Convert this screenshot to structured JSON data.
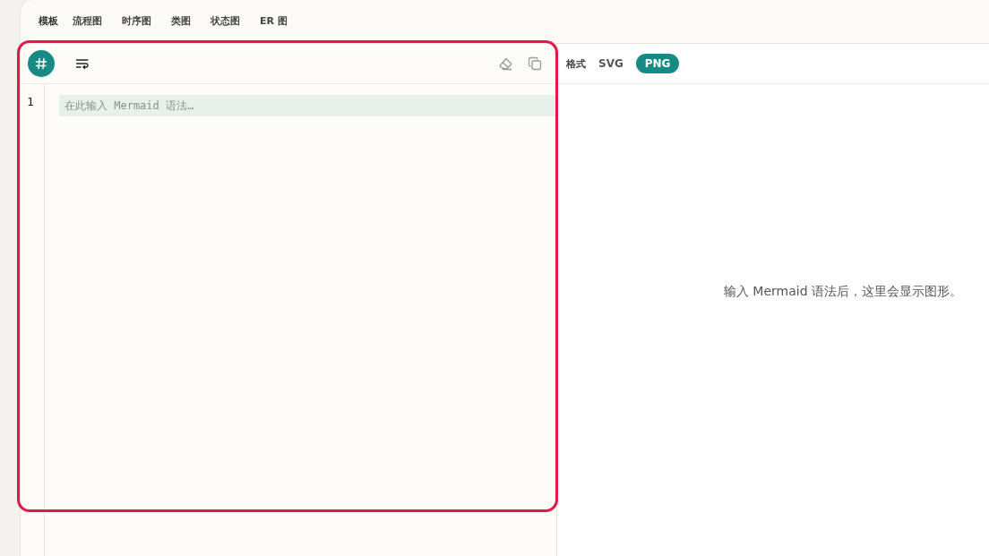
{
  "templates": {
    "label": "模板",
    "items": [
      "流程图",
      "时序图",
      "类图",
      "状态图",
      "ER 图"
    ]
  },
  "editor": {
    "tools": [
      {
        "kind": "line-numbers",
        "on": true
      },
      {
        "kind": "wrap",
        "on": false
      }
    ],
    "lines": [
      {
        "number": "1",
        "placeholder": "在此输入 Mermaid 语法…"
      }
    ],
    "highlighted": true
  },
  "preview": {
    "format_label": "格式",
    "formats": [
      {
        "label": "SVG",
        "selected": false
      },
      {
        "label": "PNG",
        "selected": true
      }
    ],
    "empty_message": "输入 Mermaid 语法后，这里会显示图形。"
  }
}
